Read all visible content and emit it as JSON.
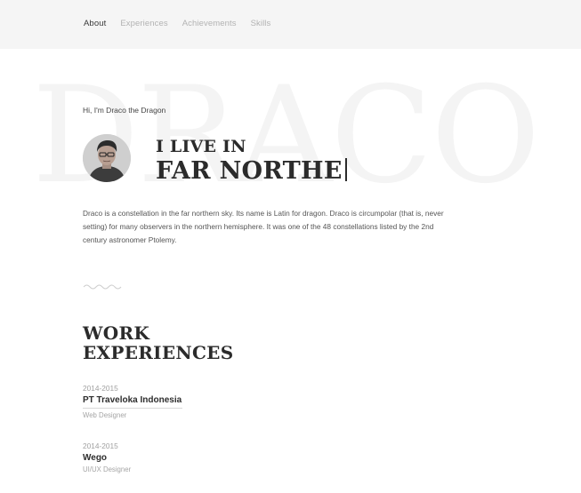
{
  "nav": {
    "items": [
      {
        "label": "About",
        "active": true
      },
      {
        "label": "Experiences",
        "active": false
      },
      {
        "label": "Achievements",
        "active": false
      },
      {
        "label": "Skills",
        "active": false
      }
    ]
  },
  "hero": {
    "background_word": "DRACO",
    "greeting": "Hi, I'm Draco the Dragon",
    "headline_line1": "I LIVE IN",
    "headline_line2": "FAR NORTHE",
    "bio": "Draco is a constellation in the far northern sky. Its name is Latin for dragon. Draco is circumpolar (that is, never setting) for many observers in the northern hemisphere. It was one of the 48 constellations listed by the 2nd century astronomer Ptolemy."
  },
  "experiences": {
    "title_line1": "WORK",
    "title_line2": "EXPERIENCES",
    "items": [
      {
        "period": "2014-2015",
        "company": "PT Traveloka Indonesia",
        "role": "Web Designer"
      },
      {
        "period": "2014-2015",
        "company": "Wego",
        "role": "UI/UX Designer"
      }
    ]
  },
  "colors": {
    "nav_background": "#f5f5f5",
    "text_dark": "#2b2b2b",
    "text_muted": "#a0a0a0",
    "watermark": "#f4f4f4"
  }
}
